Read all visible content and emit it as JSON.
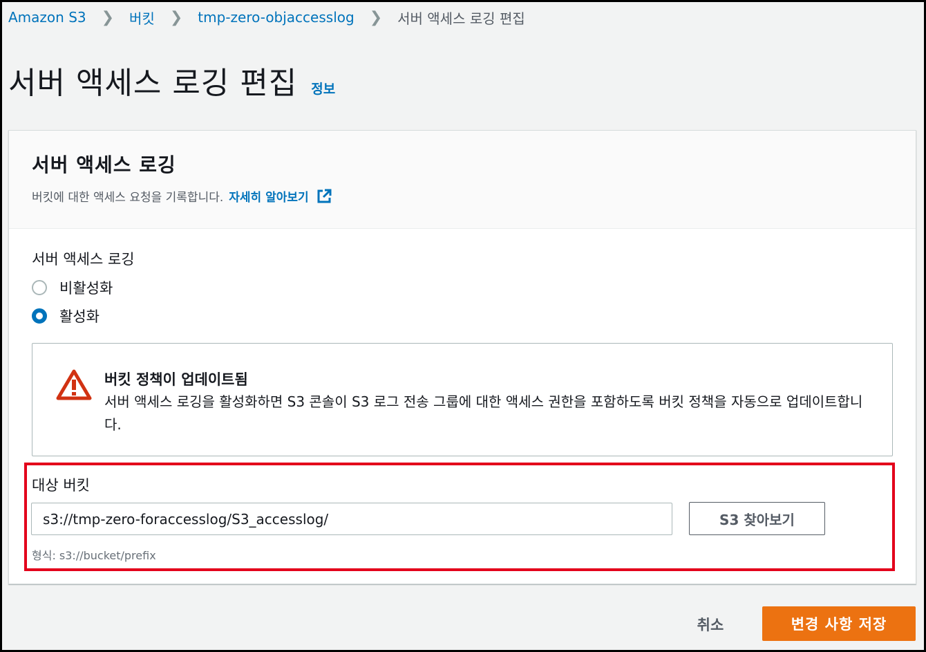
{
  "breadcrumb": {
    "items": [
      "Amazon S3",
      "버킷",
      "tmp-zero-objaccesslog"
    ],
    "current": "서버 액세스 로깅 편집"
  },
  "page": {
    "title": "서버 액세스 로깅 편집",
    "info_link": "정보"
  },
  "panel": {
    "title": "서버 액세스 로깅",
    "description": "버킷에 대한 액세스 요청을 기록합니다.",
    "learn_more": "자세히 알아보기"
  },
  "logging": {
    "label": "서버 액세스 로깅",
    "options": [
      "비활성화",
      "활성화"
    ],
    "selected": "활성화"
  },
  "alert": {
    "icon": "warning-icon",
    "title": "버킷 정책이 업데이트됨",
    "body": "서버 액세스 로깅을 활성화하면 S3 콘솔이 S3 로그 전송 그룹에 대한 액세스 권한을 포함하도록 버킷 정책을 자동으로 업데이트합니다."
  },
  "target": {
    "label": "대상 버킷",
    "value": "s3://tmp-zero-foraccesslog/S3_accesslog/",
    "browse_label": "S3 찾아보기",
    "format_hint": "형식: s3://bucket/prefix"
  },
  "footer": {
    "cancel_label": "취소",
    "save_label": "변경 사항 저장"
  },
  "colors": {
    "link": "#0073bb",
    "primary_button": "#ec7211",
    "highlight_border": "#e3001b",
    "warning": "#d13212"
  }
}
